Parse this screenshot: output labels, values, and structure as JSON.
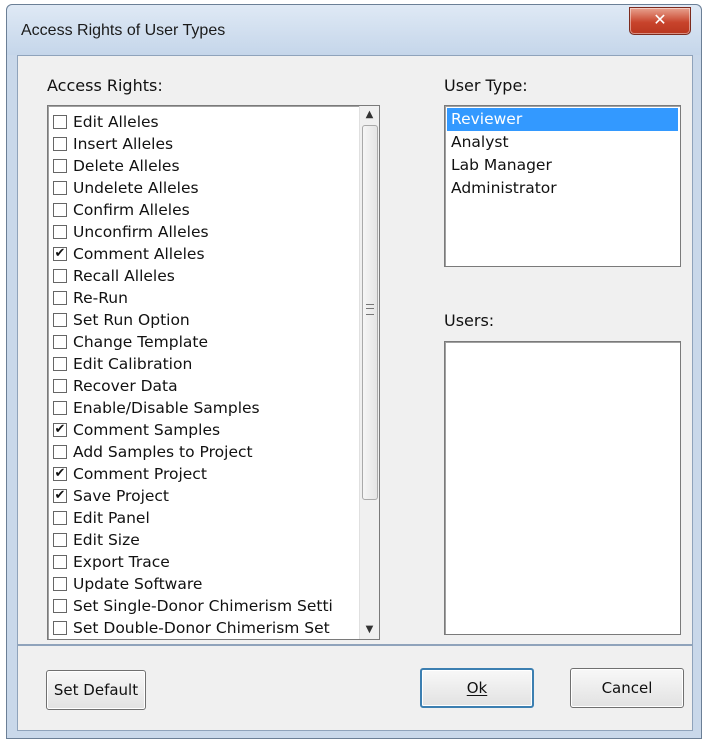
{
  "window": {
    "title": "Access Rights of User Types",
    "close_glyph": "✕"
  },
  "access_rights": {
    "label": "Access Rights:",
    "items": [
      {
        "label": "Edit Alleles",
        "checked": false
      },
      {
        "label": "Insert Alleles",
        "checked": false
      },
      {
        "label": "Delete Alleles",
        "checked": false
      },
      {
        "label": "Undelete Alleles",
        "checked": false
      },
      {
        "label": "Confirm Alleles",
        "checked": false
      },
      {
        "label": "Unconfirm Alleles",
        "checked": false
      },
      {
        "label": "Comment Alleles",
        "checked": true
      },
      {
        "label": "Recall Alleles",
        "checked": false
      },
      {
        "label": "Re-Run",
        "checked": false
      },
      {
        "label": "Set Run Option",
        "checked": false
      },
      {
        "label": "Change Template",
        "checked": false
      },
      {
        "label": "Edit Calibration",
        "checked": false
      },
      {
        "label": "Recover Data",
        "checked": false
      },
      {
        "label": "Enable/Disable Samples",
        "checked": false
      },
      {
        "label": "Comment Samples",
        "checked": true
      },
      {
        "label": "Add Samples to Project",
        "checked": false
      },
      {
        "label": "Comment Project",
        "checked": true
      },
      {
        "label": "Save Project",
        "checked": true
      },
      {
        "label": "Edit Panel",
        "checked": false
      },
      {
        "label": "Edit Size",
        "checked": false
      },
      {
        "label": "Export Trace",
        "checked": false
      },
      {
        "label": "Update Software",
        "checked": false
      },
      {
        "label": "Set Single-Donor Chimerism Setti",
        "checked": false
      },
      {
        "label": "Set Double-Donor Chimerism Set",
        "checked": false
      }
    ]
  },
  "user_type": {
    "label": "User Type:",
    "items": [
      "Reviewer",
      "Analyst",
      "Lab Manager",
      "Administrator"
    ],
    "selected_index": 0
  },
  "users": {
    "label": "Users:",
    "items": []
  },
  "buttons": {
    "set_default": "Set Default",
    "ok": "Ok",
    "cancel": "Cancel"
  },
  "colors": {
    "selection": "#3399ff",
    "close_button": "#c8442c"
  }
}
